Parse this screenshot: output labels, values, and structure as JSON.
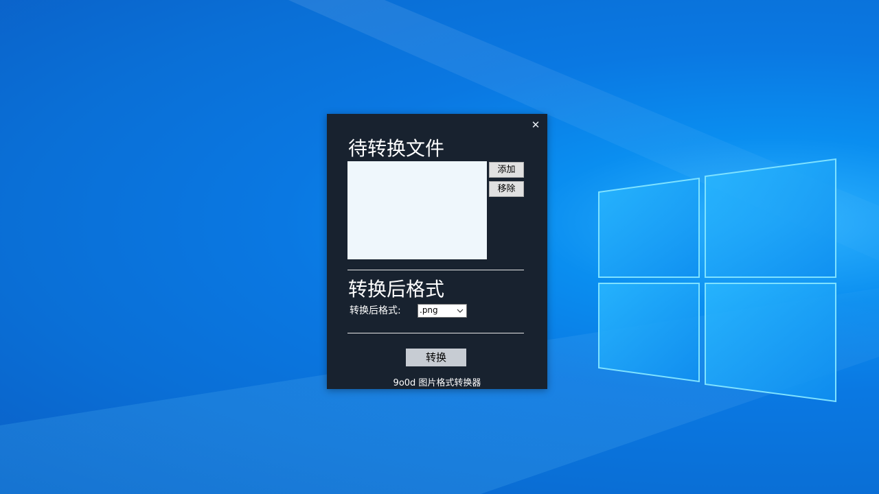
{
  "window": {
    "close_glyph": "✕",
    "files_section_title": "待转换文件",
    "add_button": "添加",
    "remove_button": "移除",
    "format_section_title": "转换后格式",
    "format_label": "转换后格式:",
    "format_selected": ".png",
    "convert_button": "转换",
    "footer": "9o0d 图片格式转换器"
  },
  "colors": {
    "window_bg": "#18222f",
    "desktop_accent": "#0a78e2",
    "list_bg": "#eff7fc"
  },
  "icons": {
    "close": "close-icon",
    "dropdown": "chevron-down-icon",
    "os_logo": "windows-logo"
  }
}
